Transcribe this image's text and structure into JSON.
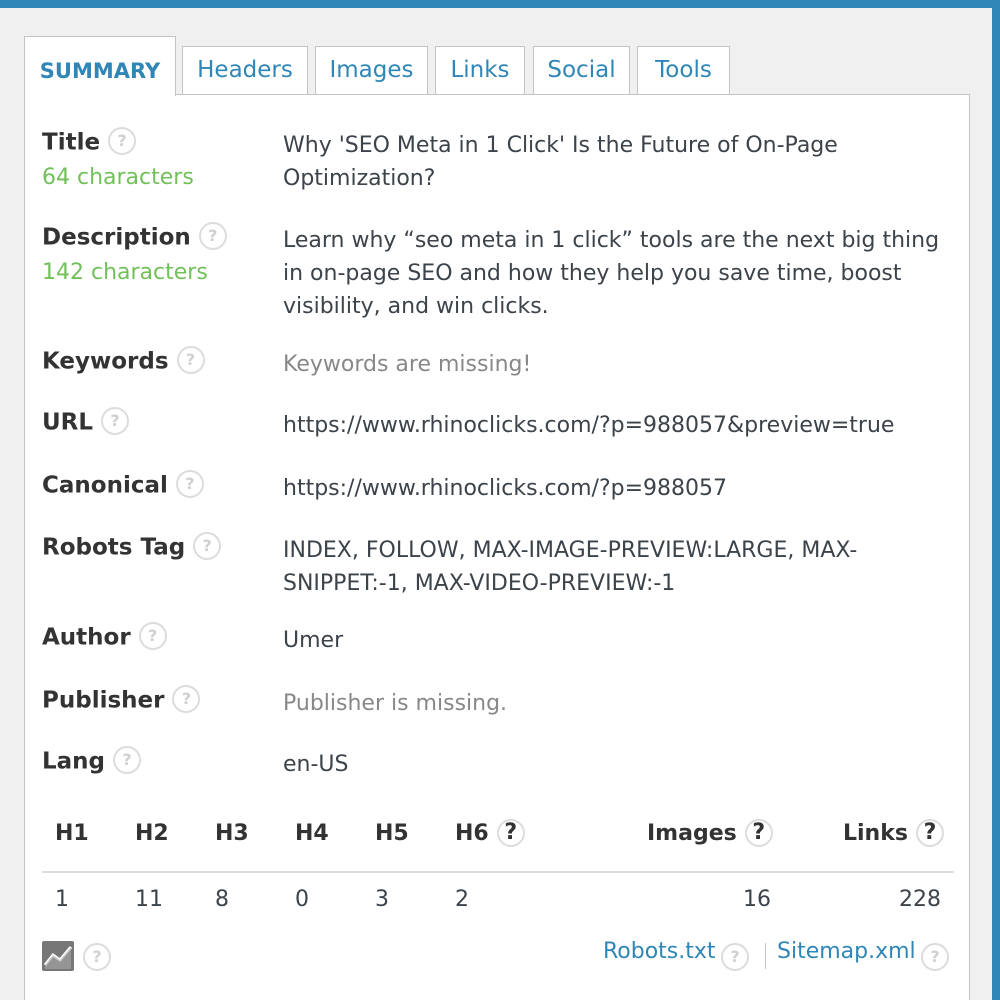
{
  "tabs": [
    "SUMMARY",
    "Headers",
    "Images",
    "Links",
    "Social",
    "Tools"
  ],
  "help_glyph": "?",
  "fields": {
    "title": {
      "label": "Title",
      "count": "64 characters",
      "value": "Why 'SEO Meta in 1 Click' Is the Future of On-Page Optimization?"
    },
    "description": {
      "label": "Description",
      "count": "142 characters",
      "value": "Learn why “seo meta in 1 click” tools are the next big thing in on-page SEO and how they help you save time, boost visibility, and win clicks."
    },
    "keywords": {
      "label": "Keywords",
      "value": "Keywords are missing!"
    },
    "url": {
      "label": "URL",
      "value": "https://www.rhinoclicks.com/?p=988057&preview=true"
    },
    "canonical": {
      "label": "Canonical",
      "value": "https://www.rhinoclicks.com/?p=988057"
    },
    "robots": {
      "label": "Robots Tag",
      "value": "INDEX, FOLLOW, MAX-IMAGE-PREVIEW:LARGE, MAX-SNIPPET:-1, MAX-VIDEO-PREVIEW:-1"
    },
    "author": {
      "label": "Author",
      "value": "Umer"
    },
    "publisher": {
      "label": "Publisher",
      "value": "Publisher is missing."
    },
    "lang": {
      "label": "Lang",
      "value": "en-US"
    }
  },
  "headings": {
    "labels": {
      "h1": "H1",
      "h2": "H2",
      "h3": "H3",
      "h4": "H4",
      "h5": "H5",
      "h6": "H6",
      "images": "Images",
      "links": "Links"
    },
    "values": {
      "h1": "1",
      "h2": "11",
      "h3": "8",
      "h4": "0",
      "h5": "3",
      "h6": "2",
      "images": "16",
      "links": "228"
    }
  },
  "footer": {
    "robots_link": "Robots.txt",
    "sitemap_link": "Sitemap.xml"
  },
  "colors": {
    "accent": "#2f86b7",
    "count_green": "#72c05a",
    "missing_gray": "#888888"
  }
}
